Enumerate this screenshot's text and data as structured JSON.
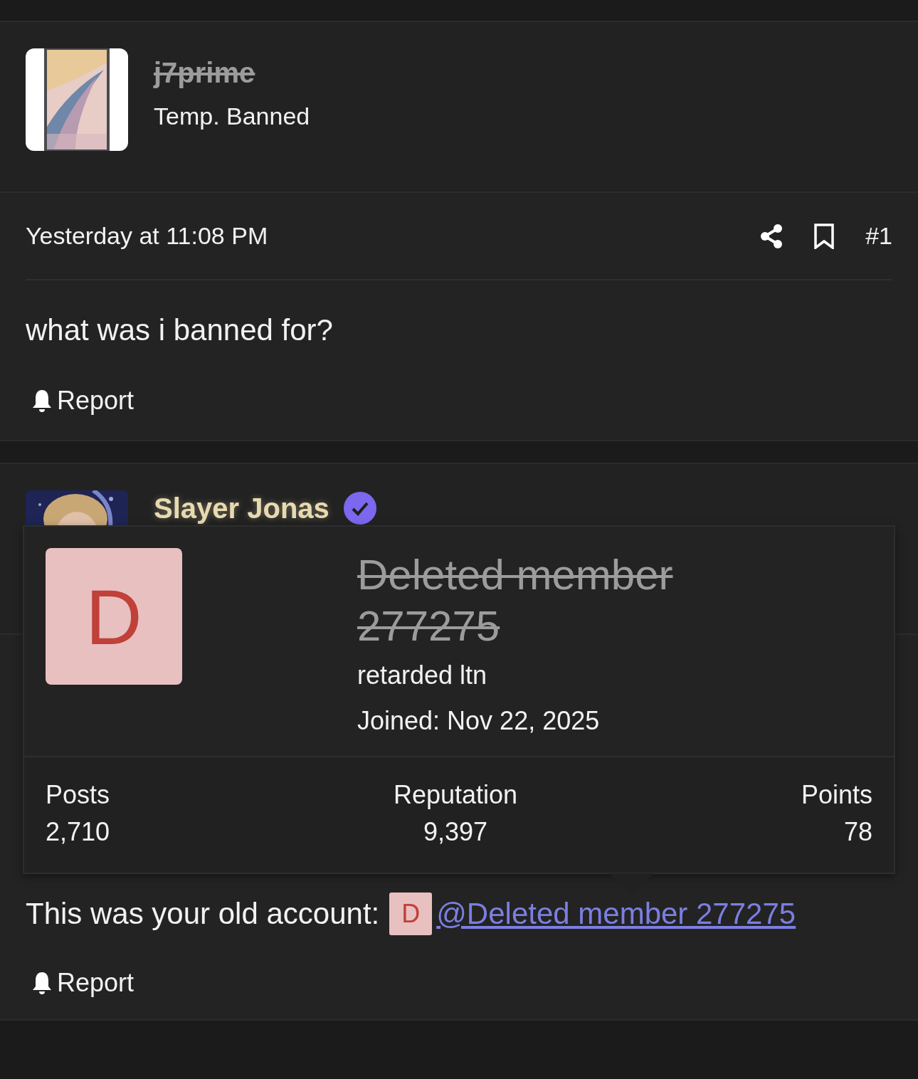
{
  "posts": [
    {
      "author": {
        "name": "j7prime",
        "banned": true,
        "title": "Temp. Banned"
      },
      "time": "Yesterday at 11:08 PM",
      "number": "#1",
      "body": "what was i banned for?",
      "report": "Report"
    },
    {
      "author": {
        "name": "Slayer Jonas",
        "verified": true
      },
      "body": "This was your old account:",
      "mention": {
        "initial": "D",
        "name": "@Deleted member 277275"
      },
      "report": "Report"
    }
  ],
  "popup": {
    "initial": "D",
    "name": "Deleted member 277275",
    "banned": true,
    "title": "retarded ltn",
    "joined": "Joined: Nov 22, 2025",
    "stats": [
      {
        "label": "Posts",
        "value": "2,710"
      },
      {
        "label": "Reputation",
        "value": "9,397"
      },
      {
        "label": "Points",
        "value": "78"
      }
    ]
  }
}
